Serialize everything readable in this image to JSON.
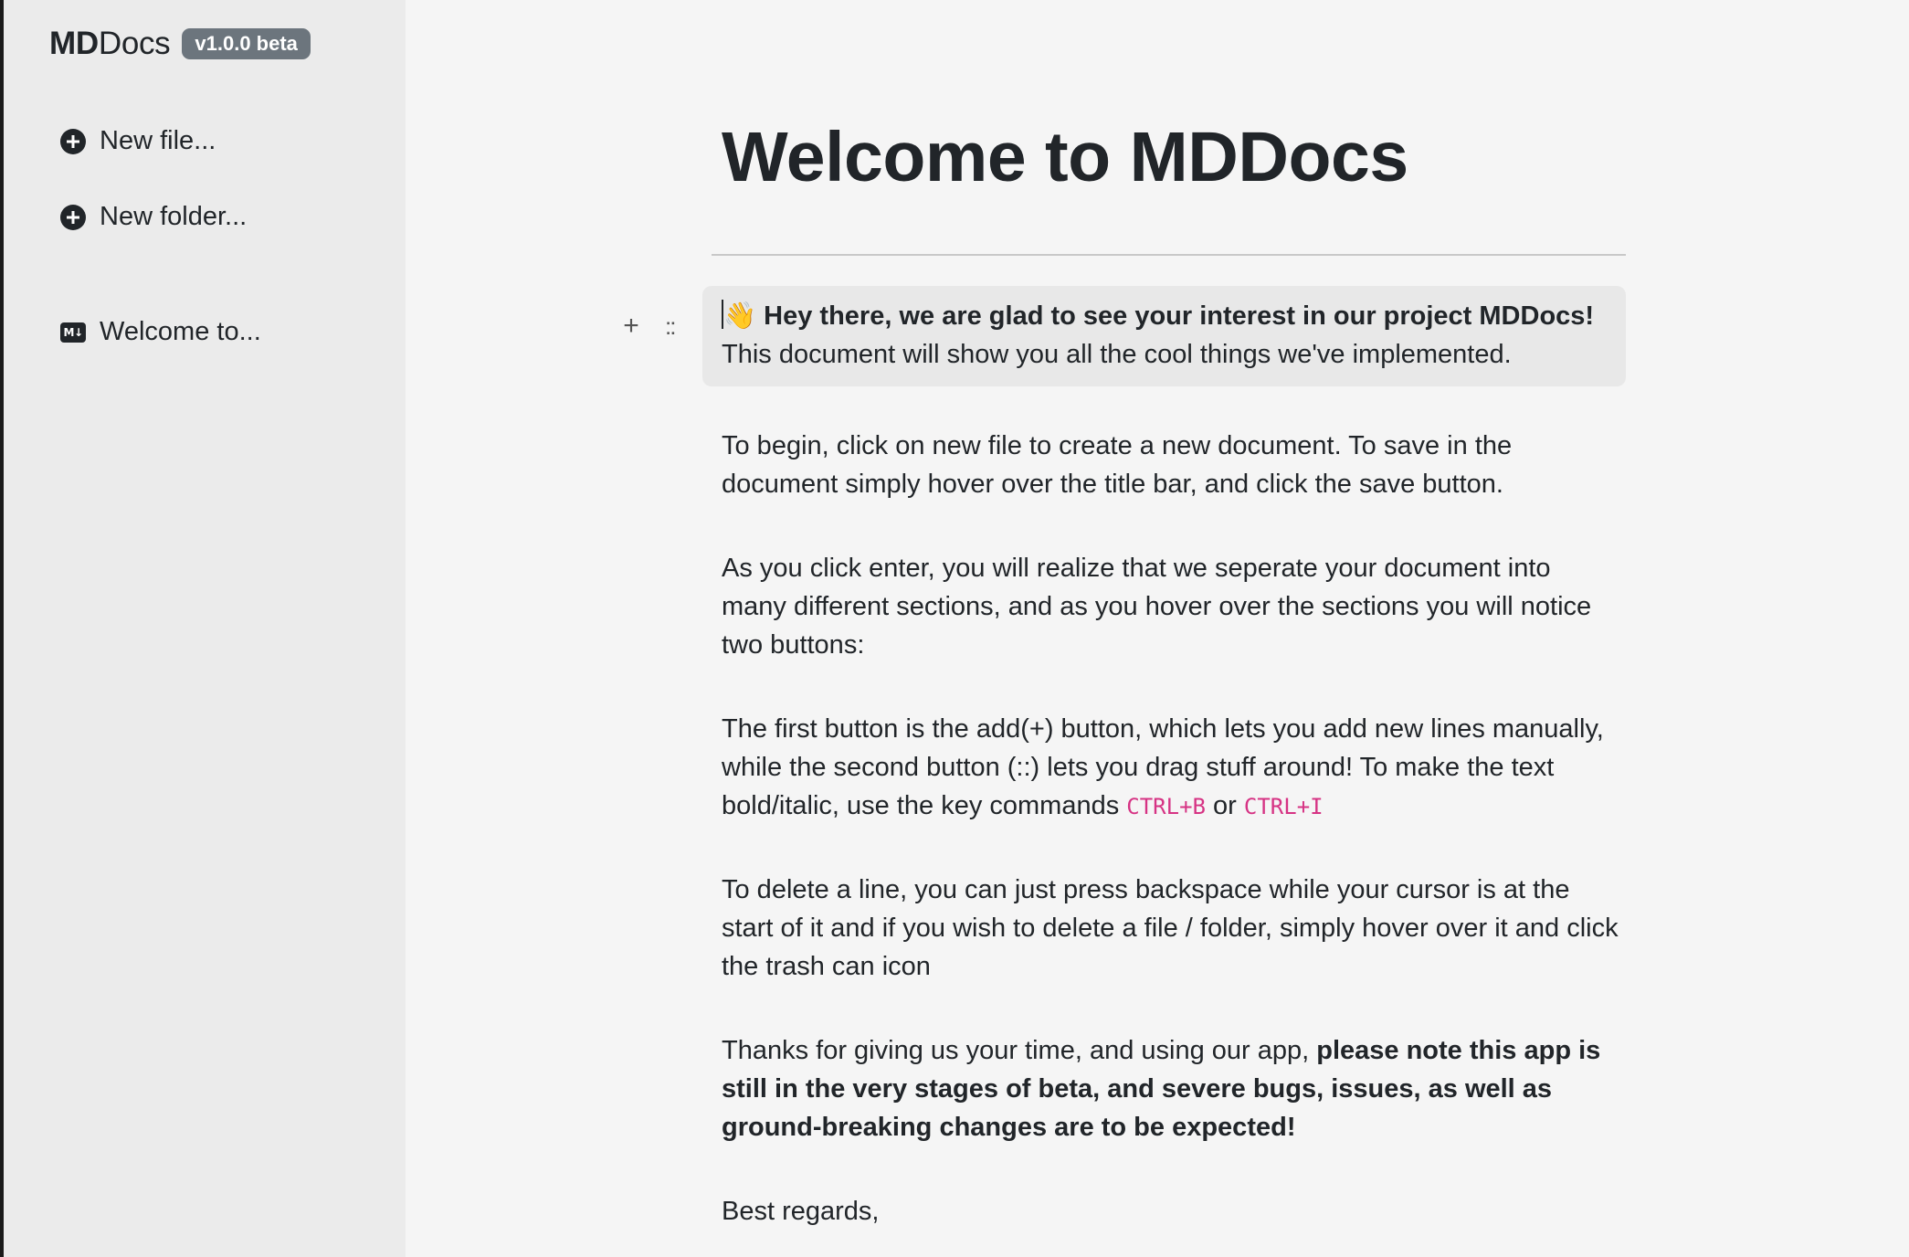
{
  "sidebar": {
    "brand_bold": "MD",
    "brand_rest": "Docs",
    "version_badge": "v1.0.0 beta",
    "actions": [
      {
        "label": "New file...",
        "icon": "plus-circle-icon"
      },
      {
        "label": "New folder...",
        "icon": "plus-circle-icon"
      }
    ],
    "files": [
      {
        "label": "Welcome to...",
        "icon": "markdown-file-icon",
        "icon_text": "M↓"
      }
    ]
  },
  "document": {
    "title": "Welcome to MDDocs",
    "block_tools": {
      "add": "+",
      "drag": "::"
    },
    "blocks": [
      {
        "emoji": "👋",
        "bold": "Hey there, we are glad to see your interest in our project MDDocs!",
        "text": "This document will show you all the cool things we've implemented."
      },
      {
        "text": "To begin, click on new file to create a new document. To save in the document simply hover over the title bar, and click the save button."
      },
      {
        "text": "As you click enter, you will realize that we seperate your document into many different sections, and as you hover over the sections you will notice two buttons:"
      },
      {
        "text": "The first button is the add(+) button, which lets you add new lines manually, while the second button (::) lets you drag stuff around! To make the text bold/italic, use the key commands",
        "code1": "CTRL+B",
        "or": "or",
        "code2": "CTRL+I"
      },
      {
        "text": "To delete a line, you can just press backspace while your cursor is at the start of it and if you wish to delete a file / folder, simply hover over it and click the trash can icon"
      },
      {
        "text": "Thanks for giving us your time, and using our app,",
        "bold": "please note this app is still in the very stages of beta, and severe bugs, issues, as well as ground-breaking changes are to be expected!"
      },
      {
        "text": "Best regards,"
      }
    ]
  },
  "colors": {
    "sidebar_bg": "#ebebeb",
    "main_bg": "#f5f5f5",
    "badge_bg": "#6c757d",
    "code_color": "#d63384",
    "highlight_block": "#e8e8e8"
  }
}
